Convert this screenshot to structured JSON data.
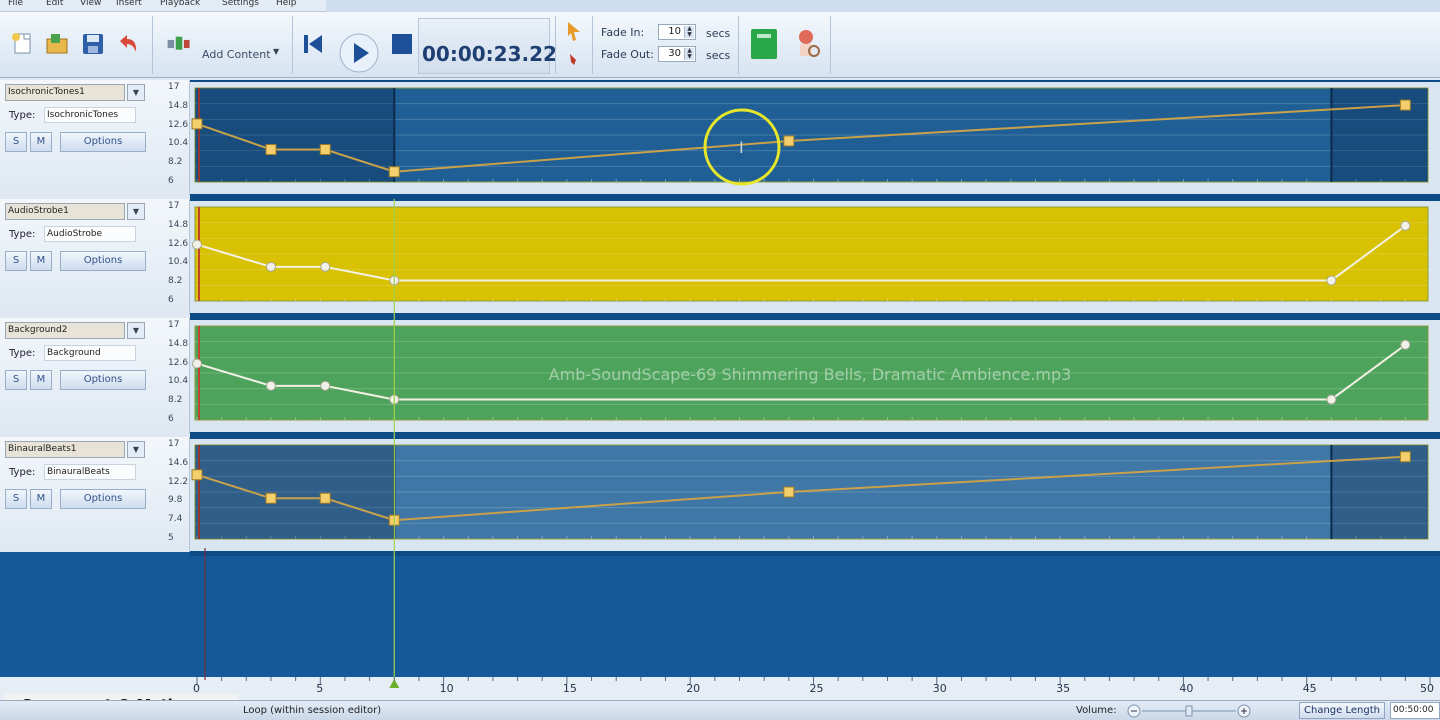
{
  "menu": [
    "File",
    "Edit",
    "View",
    "Insert",
    "Playback",
    "Settings",
    "Help"
  ],
  "toolbar": {
    "add_content": "Add Content",
    "time": "00:00:23.22",
    "fade_in_label": "Fade In:",
    "fade_in_value": "10",
    "fade_out_label": "Fade Out:",
    "fade_out_value": "30",
    "secs": "secs"
  },
  "tracks": [
    {
      "name": "IsochronicTones1",
      "type_label": "Type:",
      "type": "IsochronicTones",
      "solo": "S",
      "mute": "M",
      "options": "Options",
      "yticks": [
        "17",
        "14.8",
        "12.6",
        "10.4",
        "8.2",
        "6"
      ],
      "color": "#1f5f95",
      "points": [
        [
          0,
          12.8
        ],
        [
          3,
          9.8
        ],
        [
          5.2,
          9.8
        ],
        [
          8,
          7.2
        ],
        [
          24,
          10.8
        ],
        [
          49,
          15
        ]
      ]
    },
    {
      "name": "AudioStrobe1",
      "type_label": "Type:",
      "type": "AudioStrobe",
      "solo": "S",
      "mute": "M",
      "options": "Options",
      "yticks": [
        "17",
        "14.8",
        "12.6",
        "10.4",
        "8.2",
        "6"
      ],
      "color": "#d7c100",
      "points": [
        [
          0,
          12.6
        ],
        [
          3,
          10
        ],
        [
          5.2,
          10
        ],
        [
          8,
          8.4
        ],
        [
          46,
          8.4
        ],
        [
          49,
          14.8
        ]
      ]
    },
    {
      "name": "Background2",
      "type_label": "Type:",
      "type": "Background",
      "solo": "S",
      "mute": "M",
      "options": "Options",
      "yticks": [
        "17",
        "14.8",
        "12.6",
        "10.4",
        "8.2",
        "6"
      ],
      "color": "#4ea35c",
      "clip_label": "Amb-SoundScape-69 Shimmering Bells, Dramatic Ambience.mp3",
      "points": [
        [
          0,
          12.6
        ],
        [
          3,
          10
        ],
        [
          5.2,
          10
        ],
        [
          8,
          8.4
        ],
        [
          46,
          8.4
        ],
        [
          49,
          14.8
        ]
      ]
    },
    {
      "name": "BinauralBeats1",
      "type_label": "Type:",
      "type": "BinauralBeats",
      "solo": "S",
      "mute": "M",
      "options": "Options",
      "yticks": [
        "17",
        "14.6",
        "12.2",
        "9.8",
        "7.4",
        "5"
      ],
      "color": "#3f77a6",
      "points": [
        [
          0,
          13.2
        ],
        [
          3,
          10.2
        ],
        [
          5.2,
          10.2
        ],
        [
          8,
          7.4
        ],
        [
          24,
          11
        ],
        [
          49,
          15.5
        ]
      ]
    }
  ],
  "timeline": {
    "ticks": [
      "0",
      "5",
      "10",
      "15",
      "20",
      "25",
      "30",
      "35",
      "40",
      "45",
      "50"
    ],
    "playhead": 8
  },
  "watermark": "Screencast-O-Matic.com",
  "status": {
    "text": "Loop (within session editor)",
    "volume_label": "Volume:",
    "change_length": "Change Length",
    "length_value": "00:50:00"
  },
  "colors": {
    "accent_point": "#f5cf6b",
    "blue_lane": "#1c5c93",
    "empty_area": "#15599b"
  }
}
